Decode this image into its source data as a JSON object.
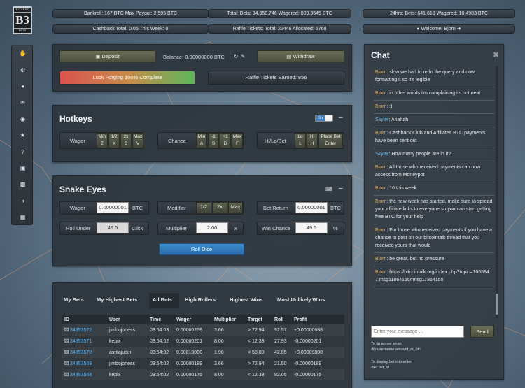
{
  "logo": {
    "top": "BITVEST",
    "mark": "B3",
    "bottom": "BETS"
  },
  "topbar": {
    "bankroll": "Bankroll: 167 BTC   Max Payout: 2.505 BTC",
    "totals": "Total: Bets: 34,350,746   Wagered: 809.3545 BTC",
    "day": "24hrs: Bets: 641,618   Wagered: 10.4983 BTC",
    "cashback": "Cashback Total: 0.05   This Week: 0",
    "raffle": "Raffle Tickets: Total: 22446   Allocated: 5768",
    "welcome": "Welcome, Bjorn"
  },
  "sidebar": {
    "items": [
      "hand-icon",
      "cog-icon",
      "user-icon",
      "chat-icon",
      "eye-icon",
      "trophy-icon",
      "help-icon",
      "card-icon",
      "image-icon",
      "exit-icon",
      "building-icon"
    ]
  },
  "account": {
    "deposit": "Deposit",
    "balance_label": "Balance: 0.00000000 BTC",
    "withdraw": "Withdraw",
    "luck": "Luck Forging 100% Complete",
    "raffle_earned": "Raffle Tickets Earned: 856"
  },
  "hotkeys": {
    "title": "Hotkeys",
    "toggle": "On",
    "wager_label": "Wager",
    "wager_keys": [
      [
        "Min",
        "Z"
      ],
      [
        "1/2",
        "X"
      ],
      [
        "2x",
        "C"
      ],
      [
        "Max",
        "V"
      ]
    ],
    "chance_label": "Chance",
    "chance_keys": [
      [
        "Min",
        "A"
      ],
      [
        "-1",
        "S"
      ],
      [
        "+1",
        "D"
      ],
      [
        "Max",
        "F"
      ]
    ],
    "hilo_label": "Hi/Lo/Bet",
    "hilo_keys": [
      [
        "Lo",
        "L"
      ],
      [
        "Hi",
        "H"
      ],
      [
        "Place Bet",
        "Enter"
      ]
    ]
  },
  "snake": {
    "title": "Snake Eyes",
    "wager_label": "Wager",
    "wager_value": "0.00000001",
    "wager_unit": "BTC",
    "modifier_label": "Modifier",
    "modifiers": [
      "1/2",
      "2x",
      "Max"
    ],
    "bet_return_label": "Bet Return",
    "bet_return_value": "0.00000001",
    "bet_return_unit": "BTC",
    "roll_under_label": "Roll Under",
    "roll_under_value": "49.5",
    "click_label": "Click",
    "multiplier_label": "Multiplier",
    "multiplier_value": "2.00",
    "multiplier_unit": "x",
    "win_chance_label": "Win Chance",
    "win_chance_value": "49.5",
    "win_chance_unit": "%",
    "roll_button": "Roll Dice"
  },
  "bets": {
    "tabs": [
      "My Bets",
      "My Highest Bets",
      "All Bets",
      "High Rollers",
      "Highest Wins",
      "Most Unlikely Wins"
    ],
    "active_tab": 2,
    "columns": [
      "ID",
      "User",
      "Time",
      "Wager",
      "Multiplier",
      "Target",
      "Roll",
      "Profit"
    ],
    "rows": [
      {
        "id": "34353572",
        "user": "jimbojoness",
        "time": "03:54:03",
        "wager": "0.00000259",
        "mult": "3.66",
        "target": "> 72.94",
        "roll": "92.57",
        "profit": "+0.00000688",
        "win": true
      },
      {
        "id": "34353571",
        "user": "kepix",
        "time": "03:54:02",
        "wager": "0.00000201",
        "mult": "8.00",
        "target": "< 12.38",
        "roll": "27.93",
        "profit": "-0.00000201",
        "win": false
      },
      {
        "id": "34353570",
        "user": "asrilajudin",
        "time": "03:54:02",
        "wager": "0.00010000",
        "mult": "1.98",
        "target": "< 50.00",
        "roll": "42.85",
        "profit": "+0.00009800",
        "win": true
      },
      {
        "id": "34353569",
        "user": "jimbojoness",
        "time": "03:54:02",
        "wager": "0.00000189",
        "mult": "3.66",
        "target": "> 72.94",
        "roll": "21.50",
        "profit": "-0.00000189",
        "win": false
      },
      {
        "id": "34353568",
        "user": "kepix",
        "time": "03:54:02",
        "wager": "0.00000175",
        "mult": "8.00",
        "target": "< 12.38",
        "roll": "92.05",
        "profit": "-0.00000175",
        "win": false
      }
    ]
  },
  "chat": {
    "title": "Chat",
    "messages": [
      {
        "user": "Bjorn",
        "text": "slow we had to redo the query and now formatting it so it's legible",
        "blue": false
      },
      {
        "user": "Bjorn",
        "text": "in other words i'm complaining its not neat",
        "blue": false
      },
      {
        "user": "Bjorn",
        "text": ":)",
        "blue": false
      },
      {
        "user": "Skyler",
        "text": "Ahahah",
        "blue": true
      },
      {
        "user": "Bjorn",
        "text": "Cashback Club and Affiliates BTC payments have been sent out",
        "blue": false
      },
      {
        "user": "Skyler",
        "text": "How many people are in it?",
        "blue": true
      },
      {
        "user": "Bjorn",
        "text": "All those who received payments can now access from Moneypot",
        "blue": false
      },
      {
        "user": "Bjorn",
        "text": "10 this week",
        "blue": false
      },
      {
        "user": "Bjorn",
        "text": "the new week has started, make sure to spread your affiliate links to everyone so you can start getting free BTC for your help",
        "blue": false
      },
      {
        "user": "Bjorn",
        "text": "For those who received payments if you have a chance to post on our bitcointalk thread that you received yours that would",
        "blue": false
      },
      {
        "user": "Bjorn",
        "text": "be great, but no pressure",
        "blue": false
      },
      {
        "user": "Bjorn",
        "text": "https://bitcointalk.org/index.php?topic=1065847.msg11864155#msg11864155",
        "blue": false
      }
    ],
    "placeholder": "Enter your message ...",
    "send": "Send",
    "tip_help": "To tip a user enter",
    "tip_cmd": "/tip username amount_in_btc",
    "bet_help": "To display bet into enter",
    "bet_cmd": "/bet bet_id"
  }
}
